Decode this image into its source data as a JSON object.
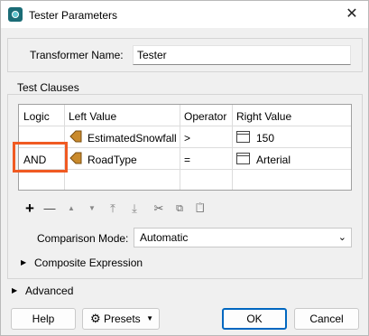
{
  "window": {
    "title": "Tester Parameters",
    "close_glyph": "✕"
  },
  "transformer": {
    "label": "Transformer Name:",
    "value": "Tester"
  },
  "test_clauses": {
    "legend": "Test Clauses",
    "columns": [
      "Logic",
      "Left Value",
      "Operator",
      "Right Value"
    ],
    "rows": [
      {
        "logic": "",
        "left": "EstimatedSnowfall",
        "left_icon": "feature-attribute-icon",
        "operator": ">",
        "right": "150",
        "right_icon": "constant-value-icon"
      },
      {
        "logic": "AND",
        "left": "RoadType",
        "left_icon": "feature-attribute-icon",
        "operator": "=",
        "right": "Arterial",
        "right_icon": "constant-value-icon"
      }
    ],
    "highlight_color": "#f05a22"
  },
  "toolbar": [
    {
      "name": "add-icon",
      "glyph": "+"
    },
    {
      "name": "remove-icon",
      "glyph": "—"
    },
    {
      "name": "move-up-icon",
      "glyph": "▲"
    },
    {
      "name": "move-down-icon",
      "glyph": "▼"
    },
    {
      "name": "move-top-icon",
      "glyph": "⤒"
    },
    {
      "name": "move-bottom-icon",
      "glyph": "⤓"
    },
    {
      "name": "cut-icon",
      "glyph": "✂"
    },
    {
      "name": "copy-icon",
      "glyph": "⧉"
    },
    {
      "name": "paste-icon",
      "glyph": "📋"
    }
  ],
  "comparison_mode": {
    "label": "Comparison Mode:",
    "value": "Automatic"
  },
  "composite_expression": {
    "label": "Composite Expression"
  },
  "advanced": {
    "label": "Advanced"
  },
  "buttons": {
    "help": "Help",
    "presets": "Presets",
    "ok": "OK",
    "cancel": "Cancel"
  },
  "colors": {
    "accent": "#0067c0",
    "app_icon": "#1b6c76",
    "feature_icon": "#c98a2c"
  }
}
